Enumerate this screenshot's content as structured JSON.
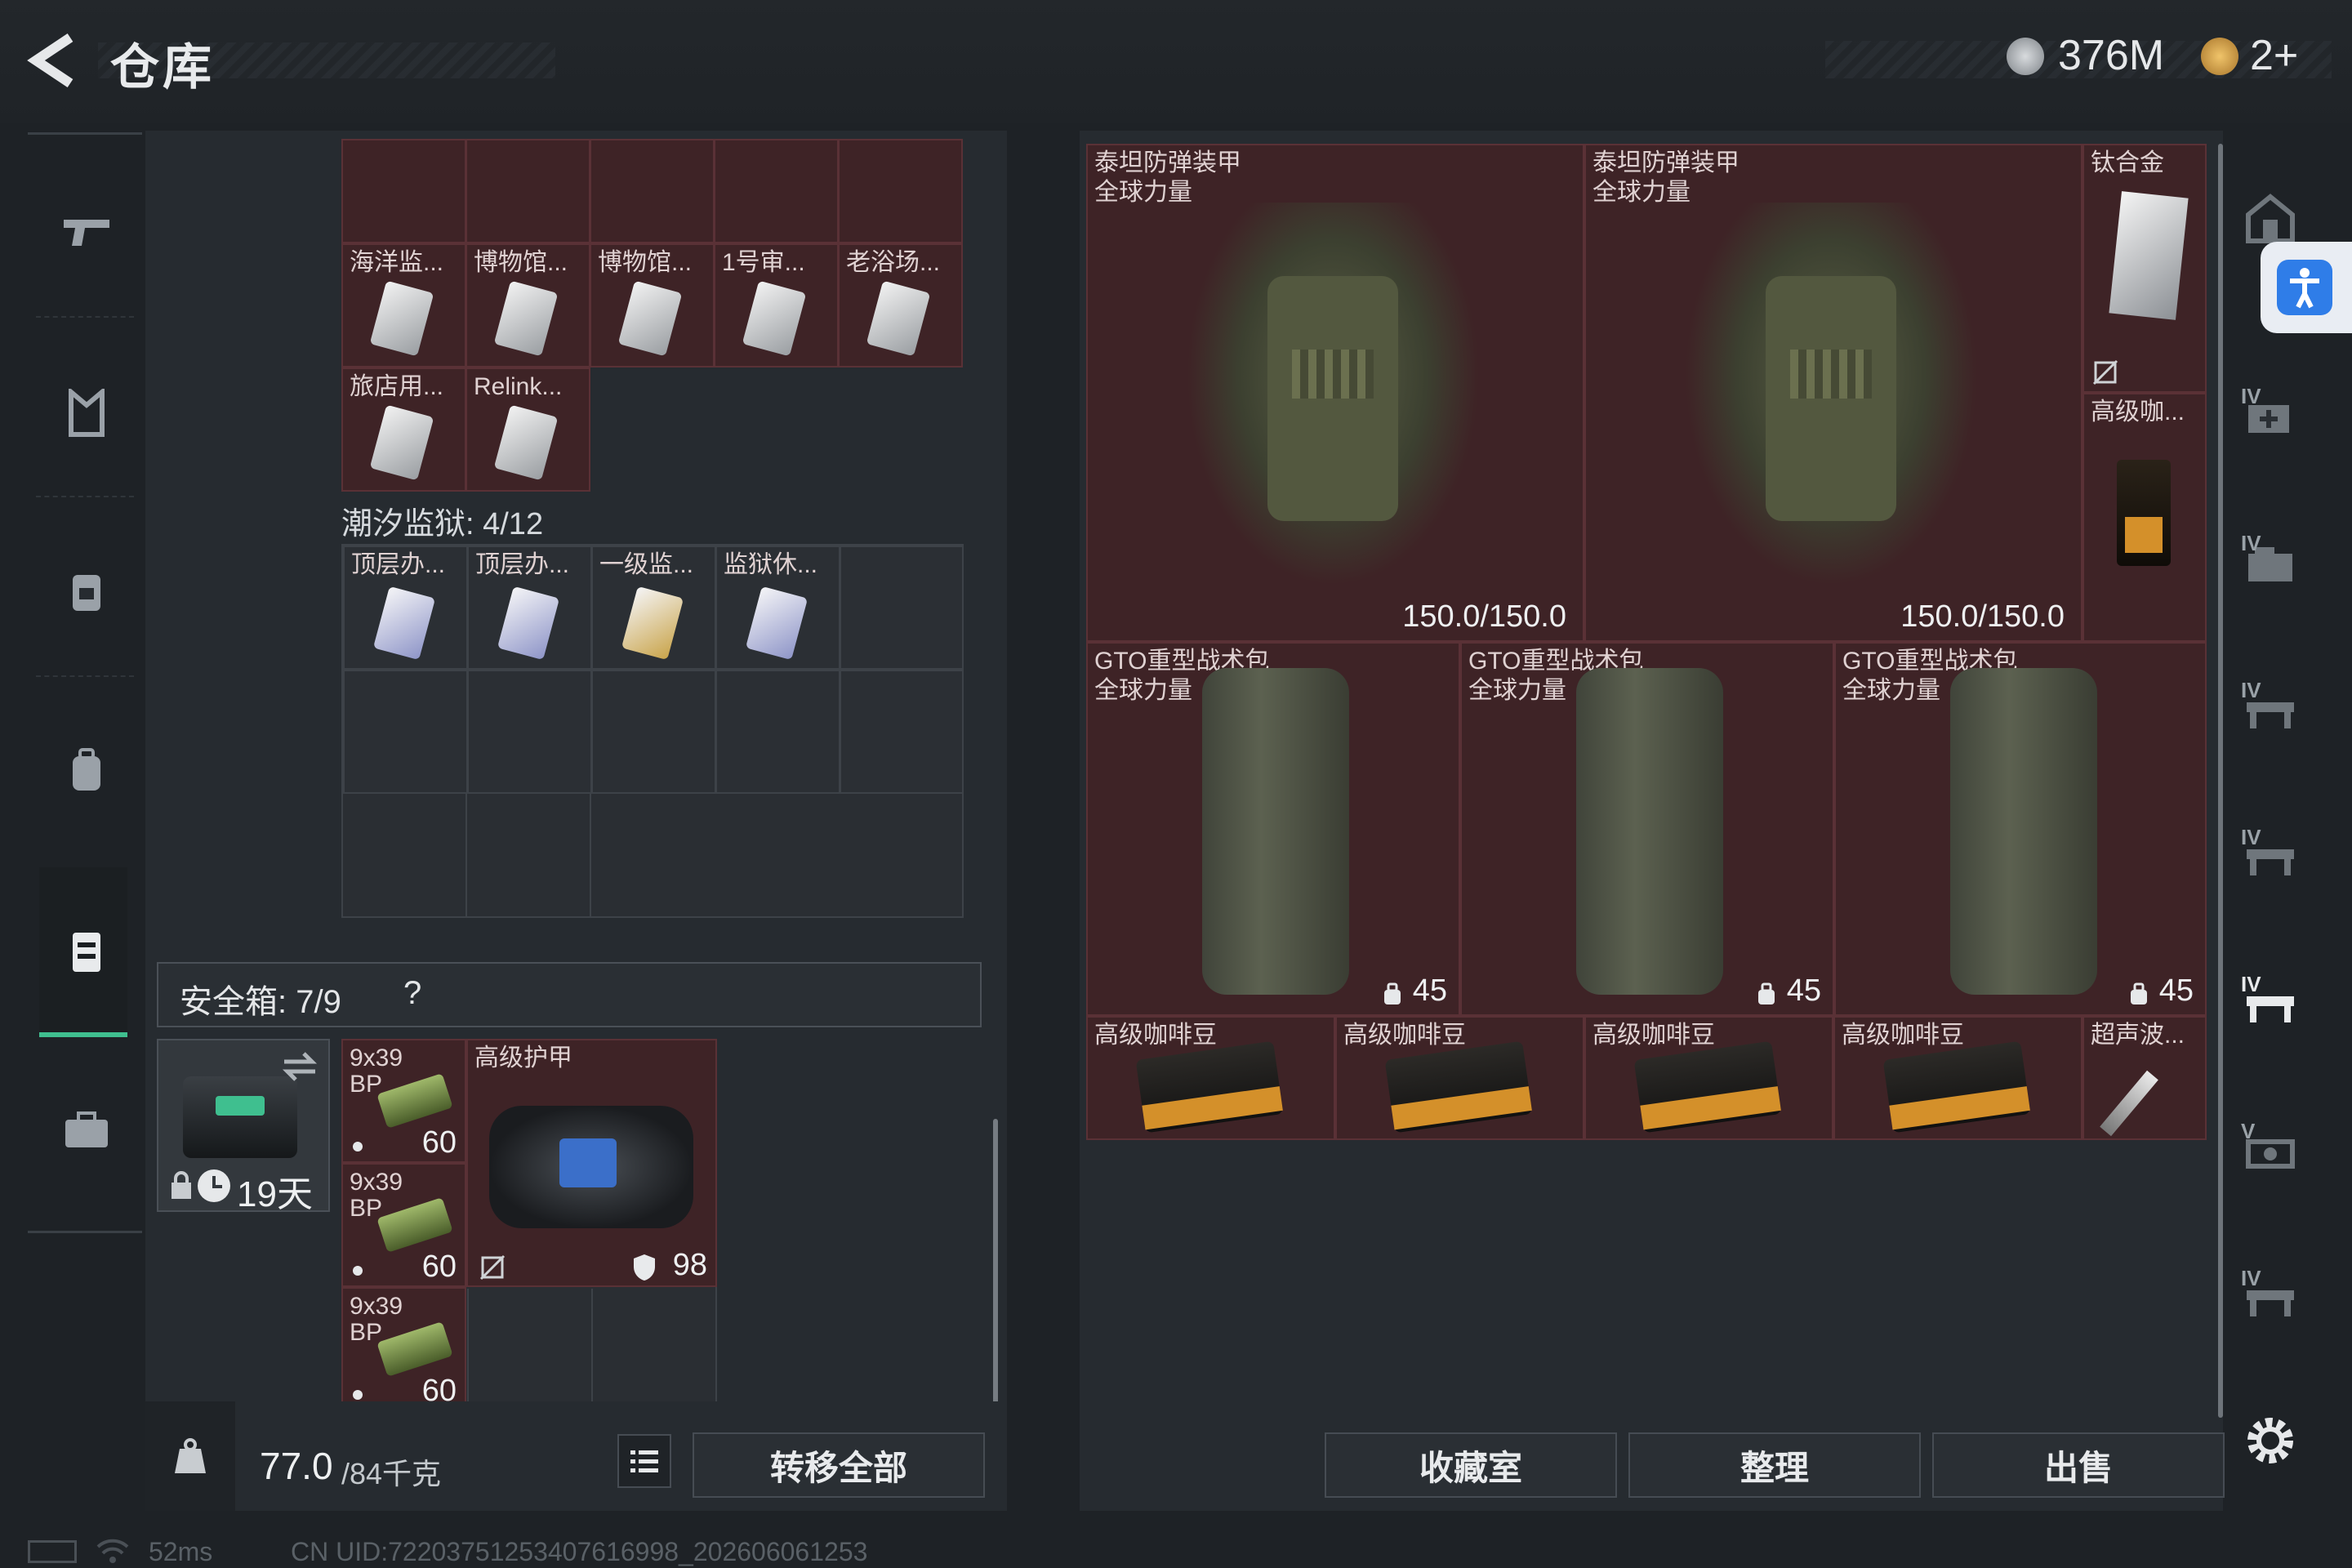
{
  "header": {
    "title": "仓库",
    "currency_amount": "376M",
    "token_amount": "2+"
  },
  "left_nav": {
    "items": [
      "weapon-icon",
      "armor-icon",
      "rig-icon",
      "backpack-icon",
      "container-icon",
      "case-icon"
    ]
  },
  "collection_grid": {
    "top_row_labels": [
      "",
      "",
      "",
      "",
      ""
    ],
    "row2_labels": [
      "海洋监...",
      "博物馆...",
      "博物馆...",
      "1号审...",
      "老浴场..."
    ],
    "row3_labels": [
      "旅店用...",
      "Relink..."
    ],
    "section_label": "潮汐监狱: 4/12",
    "prison_labels": [
      "顶层办...",
      "顶层办...",
      "一级监...",
      "监狱休..."
    ]
  },
  "safe_box": {
    "label": "安全箱: 7/9",
    "help": "?",
    "timer": "19天",
    "ammo_label": "9x39",
    "ammo_sub": "BP",
    "ammo_count": "60",
    "armor_item_label": "高级护甲",
    "armor_value": "98"
  },
  "weight": {
    "current": "77.0",
    "max": "/84千克"
  },
  "transfer_all_label": "转移全部",
  "stash": {
    "armor_label": "泰坦防弹装甲",
    "armor_sub": "全球力量",
    "armor_durability": "150.0/150.0",
    "titanium_label": "钛合金",
    "coffee_label_short": "高级咖...",
    "backpack_label": "GTO重型战术包",
    "backpack_sub": "全球力量",
    "backpack_capacity": "45",
    "coffee_bean_label": "高级咖啡豆",
    "ultrasonic_label": "超声波..."
  },
  "bottom_buttons": {
    "collection": "收藏室",
    "organize": "整理",
    "sell": "出售"
  },
  "status_bar": {
    "ping": "52ms",
    "uid": "CN UID:72203751253407616998_202606061253"
  },
  "right_nav_labels": [
    "IV",
    "IV",
    "IV",
    "IV",
    "IV",
    "V",
    "IV"
  ],
  "colors": {
    "item_red": "#3e2326",
    "panel": "#262b30",
    "accent_green": "#3fbf8f",
    "accessibility_blue": "#2f7de8"
  }
}
